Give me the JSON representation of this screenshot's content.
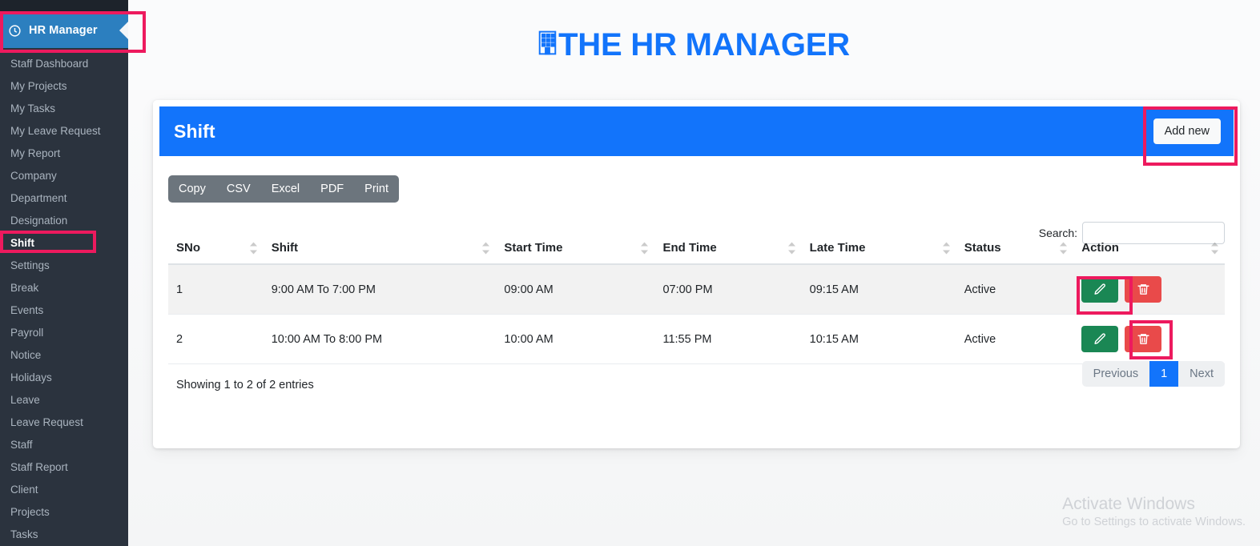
{
  "sidebar": {
    "brand": {
      "label": "HR Manager",
      "icon": "clock-icon",
      "collapse_icon": "caret-left-icon"
    },
    "items": [
      {
        "label": "Staff Dashboard",
        "active": false
      },
      {
        "label": "My Projects",
        "active": false
      },
      {
        "label": "My Tasks",
        "active": false
      },
      {
        "label": "My Leave Request",
        "active": false
      },
      {
        "label": "My Report",
        "active": false
      },
      {
        "label": "Company",
        "active": false
      },
      {
        "label": "Department",
        "active": false
      },
      {
        "label": "Designation",
        "active": false
      },
      {
        "label": "Shift",
        "active": true
      },
      {
        "label": "Settings",
        "active": false
      },
      {
        "label": "Break",
        "active": false
      },
      {
        "label": "Events",
        "active": false
      },
      {
        "label": "Payroll",
        "active": false
      },
      {
        "label": "Notice",
        "active": false
      },
      {
        "label": "Holidays",
        "active": false
      },
      {
        "label": "Leave",
        "active": false
      },
      {
        "label": "Leave Request",
        "active": false
      },
      {
        "label": "Staff",
        "active": false
      },
      {
        "label": "Staff Report",
        "active": false
      },
      {
        "label": "Client",
        "active": false
      },
      {
        "label": "Projects",
        "active": false
      },
      {
        "label": "Tasks",
        "active": false
      }
    ]
  },
  "header": {
    "title": "THE HR MANAGER",
    "icon": "building-icon",
    "color": "#1274fb"
  },
  "card": {
    "title": "Shift",
    "header_color": "#1274fb",
    "add_new_label": "Add new"
  },
  "export_buttons": [
    {
      "label": "Copy"
    },
    {
      "label": "CSV"
    },
    {
      "label": "Excel"
    },
    {
      "label": "PDF"
    },
    {
      "label": "Print"
    }
  ],
  "search": {
    "label": "Search:",
    "value": "",
    "placeholder": ""
  },
  "table": {
    "columns": [
      "SNo",
      "Shift",
      "Start Time",
      "End Time",
      "Late Time",
      "Status",
      "Action"
    ],
    "rows": [
      {
        "sno": "1",
        "shift": "9:00 AM To 7:00 PM",
        "start_time": "09:00 AM",
        "end_time": "07:00 PM",
        "late_time": "09:15 AM",
        "status": "Active",
        "actions": [
          "edit-icon",
          "trash-icon"
        ]
      },
      {
        "sno": "2",
        "shift": "10:00 AM To 8:00 PM",
        "start_time": "10:00 AM",
        "end_time": "11:55 PM",
        "late_time": "10:15 AM",
        "status": "Active",
        "actions": [
          "edit-icon",
          "trash-icon"
        ]
      }
    ]
  },
  "footer": {
    "info": "Showing 1 to 2 of 2 entries",
    "pagination": {
      "previous": "Previous",
      "pages": [
        "1"
      ],
      "next": "Next",
      "current": "1"
    }
  },
  "watermark": {
    "title": "Activate Windows",
    "subtitle": "Go to Settings to activate Windows."
  },
  "annotations": {
    "highlight_color": "#ed1a5e"
  }
}
